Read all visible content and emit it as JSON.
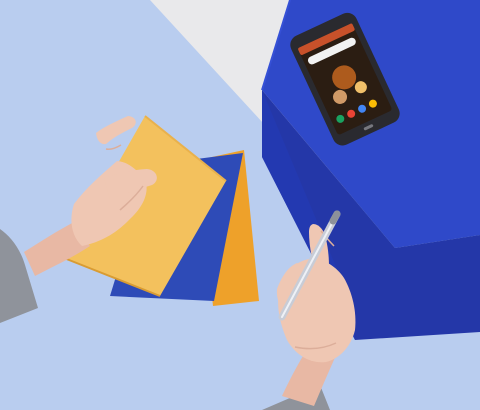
{
  "scene": {
    "palette": {
      "table": "#b9cdef",
      "table_shadow": "#a9bfe6",
      "wall": "#e9e9eb",
      "blue_block_top": "#2f49c9",
      "blue_block_side": "#2437a8",
      "blue_block_front": "#243bb5",
      "notebook_yellow": "#f3c15d",
      "notebook_orange": "#eea12a",
      "notebook_blue": "#2e4bb7",
      "phone_frame": "#2a2a2f",
      "phone_screen": "#2b1d12",
      "skin": "#efc7b3",
      "sleeve": "#8f939b",
      "pen_silver": "#c8ccd6"
    },
    "objects": [
      {
        "name": "notebook-stack",
        "count": 3
      },
      {
        "name": "smartphone"
      },
      {
        "name": "blue-block"
      },
      {
        "name": "left-hand"
      },
      {
        "name": "right-hand"
      },
      {
        "name": "pen"
      }
    ]
  }
}
